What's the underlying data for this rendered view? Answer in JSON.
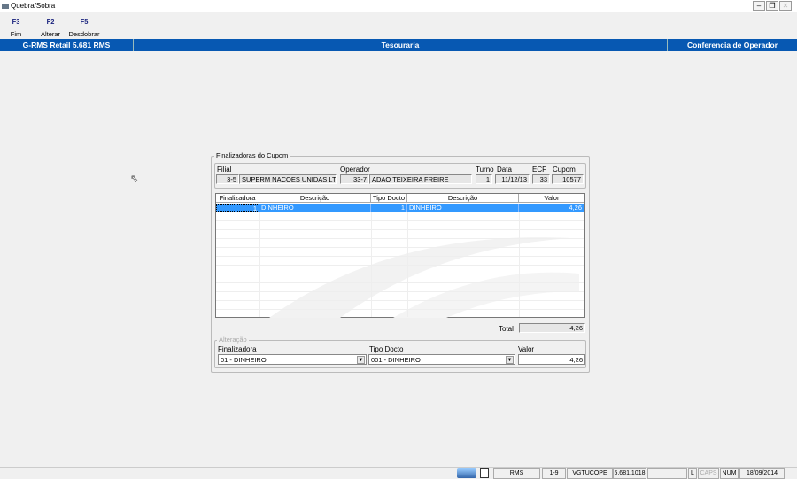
{
  "window": {
    "title": "Quebra/Sobra",
    "minimize": "–",
    "restore": "❐",
    "close": "✕"
  },
  "toolbar": [
    {
      "key": "F3",
      "label": "Fim"
    },
    {
      "key": "F2",
      "label": "Alterar"
    },
    {
      "key": "F5",
      "label": "Desdobrar"
    }
  ],
  "banner": {
    "left": "G-RMS Retail 5.681 RMS",
    "center": "Tesouraria",
    "right": "Conferencia de Operador"
  },
  "group": {
    "title": "Finalizadoras do Cupom"
  },
  "header": {
    "filial_label": "Filial",
    "filial_code": "3-5",
    "filial_name": "SUPERM NACOES UNIDAS LTDA",
    "operador_label": "Operador",
    "operador_code": "33-7",
    "operador_name": "ADAO TEIXEIRA FREIRE",
    "turno_label": "Turno",
    "turno": "1",
    "data_label": "Data",
    "data": "11/12/13",
    "ecf_label": "ECF",
    "ecf": "33",
    "cupom_label": "Cupom",
    "cupom": "10577"
  },
  "grid": {
    "columns": [
      "Finalizadora",
      "Descrição",
      "Tipo Docto",
      "Descrição",
      "Valor"
    ],
    "rows": [
      [
        "1",
        "DINHEIRO",
        "1",
        "DINHEIRO",
        "4,26"
      ]
    ]
  },
  "total": {
    "label": "Total",
    "value": "4,26"
  },
  "alteracao": {
    "title": "Alteração",
    "finalizadora_label": "Finalizadora",
    "finalizadora": "01 - DINHEIRO",
    "tipo_label": "Tipo Docto",
    "tipo": "001 - DINHEIRO",
    "valor_label": "Valor",
    "valor": "4,26"
  },
  "statusbar": {
    "system": "RMS",
    "range": "1-9",
    "user": "VGTUCOPE",
    "version": "5.681.1018",
    "l": "L",
    "caps": "CAPS",
    "num": "NUM",
    "date": "18/09/2014"
  }
}
